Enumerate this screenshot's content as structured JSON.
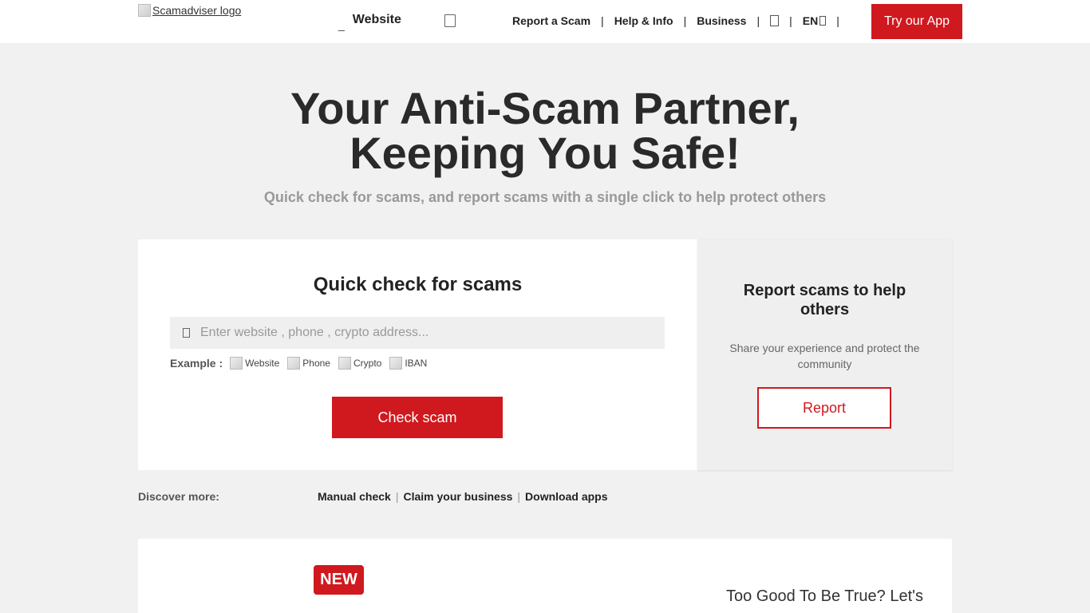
{
  "header": {
    "logo_alt": "Scamadviser logo",
    "type_select_mark": "_",
    "type_select_label": "Website",
    "nav": {
      "report": "Report a Scam",
      "help": "Help & Info",
      "business": "Business",
      "separator": "|",
      "lang": "EN"
    },
    "try_app_label": "Try our App"
  },
  "hero": {
    "title_line1": "Your Anti-Scam Partner,",
    "title_line2": "Keeping You Safe!",
    "subtitle": "Quick check for scams, and report scams with a single click to help protect others"
  },
  "check": {
    "title": "Quick check for scams",
    "placeholder": "Enter website , phone , crypto address...",
    "example_label": "Example :",
    "examples": [
      "Website",
      "Phone",
      "Crypto",
      "IBAN"
    ],
    "button_label": "Check scam"
  },
  "report": {
    "title": "Report scams to help others",
    "description": "Share your experience and protect the community",
    "button_label": "Report"
  },
  "discover": {
    "label": "Discover more:",
    "links": [
      "Manual check",
      "Claim your business",
      "Download apps"
    ],
    "separator": "|"
  },
  "promo": {
    "badge": "NEW",
    "teaser": "Too Good To Be True? Let's"
  },
  "colors": {
    "accent_red": "#d0181f",
    "page_bg": "#f1f1f1",
    "card_bg": "#ffffff",
    "report_card_bg": "#efefef"
  },
  "icons": {
    "header_search": "search-icon",
    "nav_account": "user-icon",
    "lang_caret": "chevron-down-icon",
    "search_field": "search-icon"
  }
}
